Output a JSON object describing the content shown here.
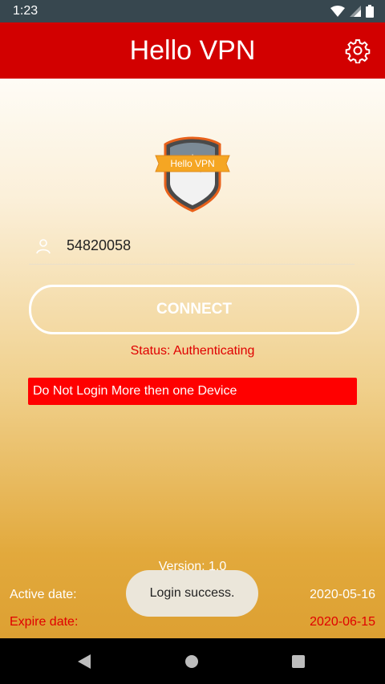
{
  "status_bar": {
    "time": "1:23",
    "icons": [
      "wifi-icon",
      "signal-icon",
      "battery-icon"
    ]
  },
  "app_bar": {
    "title": "Hello VPN",
    "settings_icon": "gear-icon"
  },
  "logo": {
    "text": "Hello VPN"
  },
  "login": {
    "username": "54820058",
    "user_icon": "person-icon"
  },
  "connect_button": {
    "label": "CONNECT"
  },
  "status": {
    "text": "Status: Authenticating"
  },
  "warning": {
    "text": "Do Not Login More then one Device"
  },
  "footer": {
    "version": "Version: 1.0",
    "active_label": "Active date:",
    "active_value": "2020-05-16",
    "expire_label": "Expire date:",
    "expire_value": "2020-06-15"
  },
  "toast": {
    "text": "Login success."
  },
  "colors": {
    "app_bar": "#d20000",
    "status_red": "#e00000",
    "warning_bg": "#ff0000",
    "accent_gold": "#dda032"
  },
  "nav_bar": {
    "icons": [
      "back-icon",
      "home-icon",
      "recents-icon"
    ]
  }
}
